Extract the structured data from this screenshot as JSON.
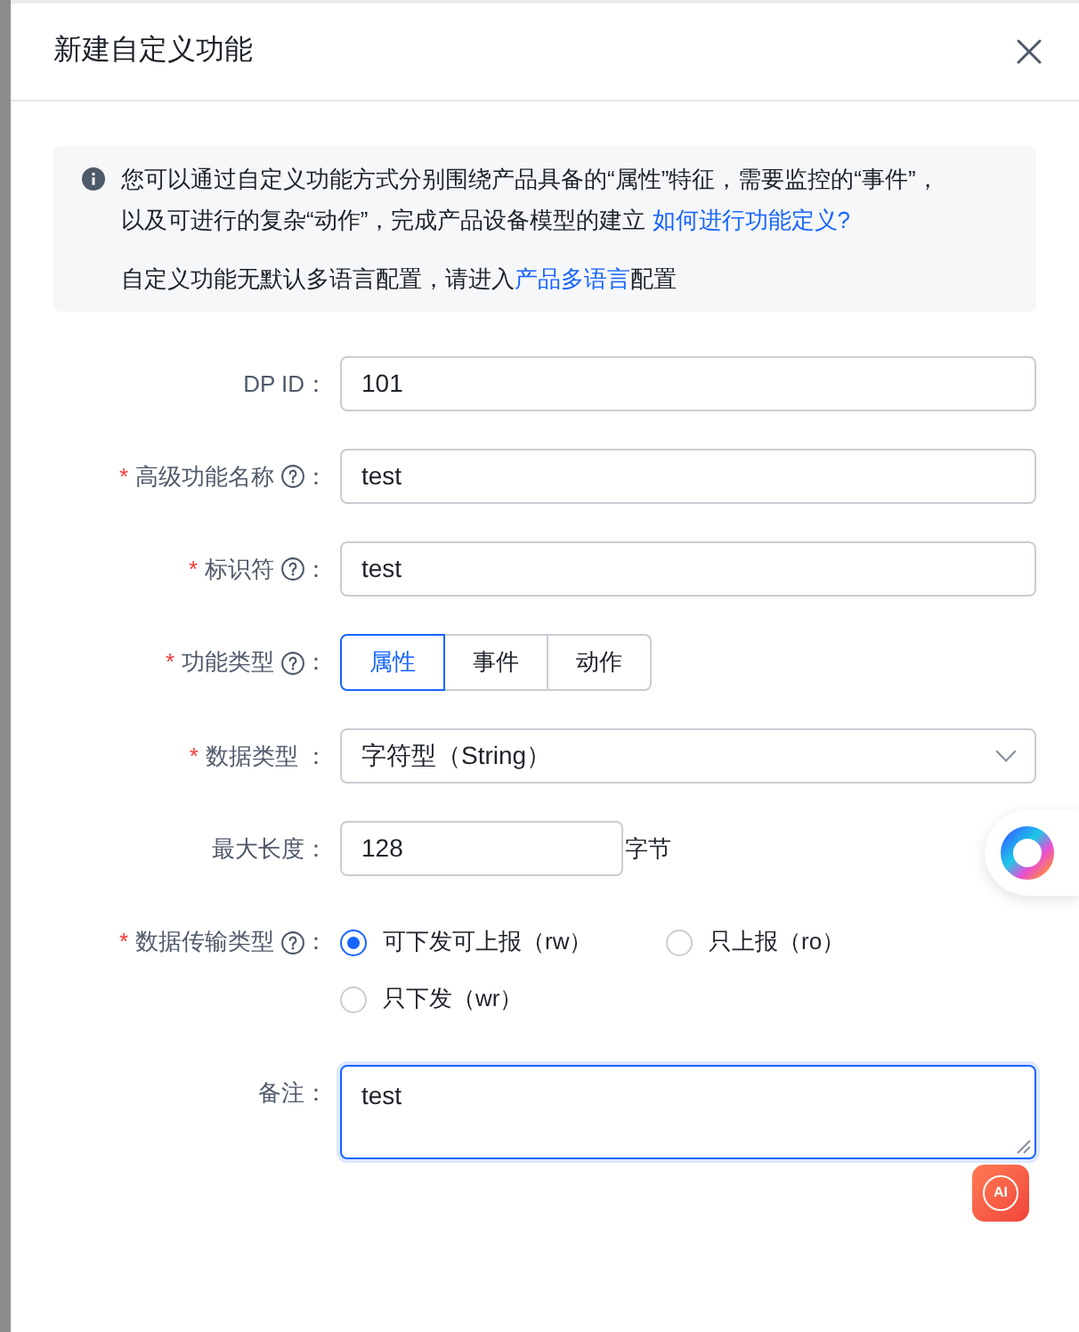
{
  "dialog": {
    "title": "新建自定义功能"
  },
  "notice": {
    "paragraphs": [
      {
        "lines": [
          [
            {
              "kind": "text",
              "text": "您可以通过自定义功能方式分别围绕产品具备的“属性”特征，需要监控的“事件”，"
            }
          ],
          [
            {
              "kind": "text",
              "text": "以及可进行的复杂“动作”，完成产品设备模型的建立 "
            },
            {
              "kind": "link",
              "text": "如何进行功能定义?"
            }
          ]
        ]
      },
      {
        "lines": [
          [
            {
              "kind": "text",
              "text": "自定义功能无默认多语言配置，请进入"
            },
            {
              "kind": "link",
              "text": "产品多语言"
            },
            {
              "kind": "text",
              "text": "配置"
            }
          ]
        ]
      }
    ]
  },
  "form": {
    "fields": [
      {
        "kind": "input",
        "label": "DP ID：",
        "value": "101"
      },
      {
        "kind": "input",
        "marker": "*",
        "label": "高级功能名称",
        "help": true,
        "colon": "：",
        "value": "test"
      },
      {
        "kind": "input",
        "marker": "*",
        "label": "标识符",
        "help": true,
        "colon": "：",
        "value": "test"
      },
      {
        "kind": "segmented",
        "marker": "*",
        "label": "功能类型",
        "help": true,
        "colon": "：",
        "options": [
          {
            "label": "属性",
            "selected": true
          },
          {
            "label": "事件",
            "selected": false
          },
          {
            "label": "动作",
            "selected": false
          }
        ]
      },
      {
        "kind": "select",
        "marker": "*",
        "label": "数据类型 ：",
        "value": "字符型（String）"
      },
      {
        "kind": "input",
        "label": "最大长度：",
        "value": "128",
        "suffix": "字节"
      },
      {
        "kind": "radio",
        "marker": "*",
        "label": "数据传输类型",
        "help": true,
        "colon": "：",
        "options": [
          {
            "label": "可下发可上报（rw）",
            "selected": true
          },
          {
            "label": "只上报（ro）",
            "selected": false
          },
          {
            "label": "只下发（wr）",
            "selected": false
          }
        ]
      },
      {
        "kind": "textarea",
        "label": "备注：",
        "value": "test",
        "focused": true
      }
    ]
  },
  "ai_button": {
    "label": "AI"
  }
}
